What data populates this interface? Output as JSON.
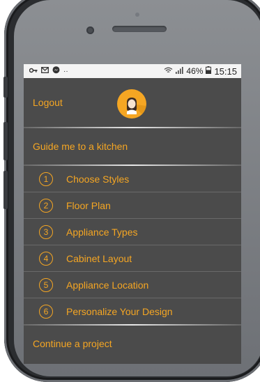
{
  "status_bar": {
    "left_icons": [
      "key-icon",
      "mail-icon",
      "messenger-icon",
      "more-icon"
    ],
    "more_text": "··",
    "battery": "46%",
    "time": "15:15"
  },
  "menu": {
    "logout_label": "Logout",
    "guide_label": "Guide me to a kitchen",
    "steps": [
      {
        "number": "1",
        "label": "Choose Styles"
      },
      {
        "number": "2",
        "label": "Floor Plan"
      },
      {
        "number": "3",
        "label": "Appliance Types"
      },
      {
        "number": "4",
        "label": "Cabinet Layout"
      },
      {
        "number": "5",
        "label": "Appliance Location"
      },
      {
        "number": "6",
        "label": "Personalize Your Design"
      }
    ],
    "continue_label": "Continue a project"
  },
  "colors": {
    "accent": "#f5a623",
    "menu_background": "#4b4b4b"
  }
}
